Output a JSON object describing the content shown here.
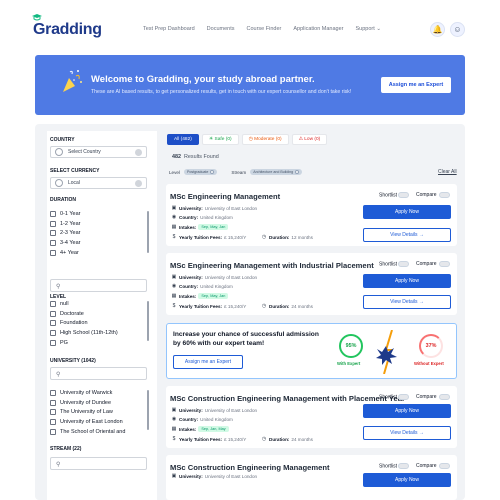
{
  "brand": {
    "name": "Gradding"
  },
  "nav": {
    "items": [
      "Test Prep Dashboard",
      "Documents",
      "Course Finder",
      "Application Manager",
      "Support"
    ]
  },
  "banner": {
    "title": "Welcome to Gradding, your study abroad partner.",
    "subtitle": "These are AI based results, to get personalized results, get in touch with our expert counsellor and don't take risk!",
    "button": "Assign me an Expert"
  },
  "sidebar": {
    "country": {
      "heading": "COUNTRY",
      "placeholder": "Select Country"
    },
    "currency": {
      "heading": "SELECT CURRENCY",
      "value": "Local"
    },
    "duration": {
      "heading": "DURATION",
      "items": [
        "0-1 Year",
        "1-2 Year",
        "2-3 Year",
        "3-4 Year",
        "4+ Year"
      ]
    },
    "level": {
      "heading": "LEVEL",
      "items": [
        "null",
        "Doctorate",
        "Foundation",
        "High School (11th-12th)",
        "PG"
      ]
    },
    "university": {
      "heading": "UNIVERSITY (1042)",
      "items": [
        "University of Warwick",
        "University of Dundee",
        "The University of Law",
        "University of East London",
        "The School of Oriental and"
      ]
    },
    "stream": {
      "heading": "STREAM (22)"
    }
  },
  "tabs": [
    {
      "label": "All (482)",
      "kind": "active"
    },
    {
      "label": "Safe (0)",
      "kind": "safe"
    },
    {
      "label": "Moderate (0)",
      "kind": "mod"
    },
    {
      "label": "Low (0)",
      "kind": "low"
    }
  ],
  "results": {
    "count": "482",
    "label": "Results Found"
  },
  "filters": {
    "level_label": "Level",
    "level_pill": "Postgraduate",
    "stream_label": "Stream",
    "stream_pill": "Architecture and Building",
    "clear": "Clear All"
  },
  "labels": {
    "university": "University:",
    "country": "Country:",
    "intakes": "Intakes:",
    "fees": "Yearly Tuition Fees:",
    "duration": "Duration:",
    "shortlist": "Shortlist",
    "compare": "Compare",
    "apply": "Apply Now",
    "view": "View Details →"
  },
  "courses": [
    {
      "title": "MSc Engineering Management",
      "university": "University of East London",
      "country": "United Kingdom",
      "intakes": "Sep, May, Jan",
      "fees": "£ 15,240/Y",
      "duration": "12 months"
    },
    {
      "title": "MSc Engineering Management with Industrial Placement",
      "university": "University of East London",
      "country": "United Kingdom",
      "intakes": "Sep, May, Jan",
      "fees": "£ 15,240/Y",
      "duration": "24 months"
    },
    {
      "title": "MSc Construction Engineering Management with Placement Year",
      "university": "University of East London",
      "country": "United Kingdom",
      "intakes": "Sep, Jan, May",
      "fees": "£ 15,240/Y",
      "duration": "24 months"
    },
    {
      "title": "MSc Construction Engineering Management",
      "university": "University of East London"
    }
  ],
  "promo": {
    "text": "Increase your chance of successful admission by 60% with our expert team!",
    "button": "Assign me an Expert",
    "with_value": "95%",
    "with_label": "With Expert",
    "without_value": "37%",
    "without_label": "Without Expert"
  },
  "colors": {
    "brand_blue": "#1e5bd6",
    "banner": "#4f7ae4",
    "safe": "#16a34a",
    "moderate": "#ea580c",
    "low": "#dc2626"
  }
}
